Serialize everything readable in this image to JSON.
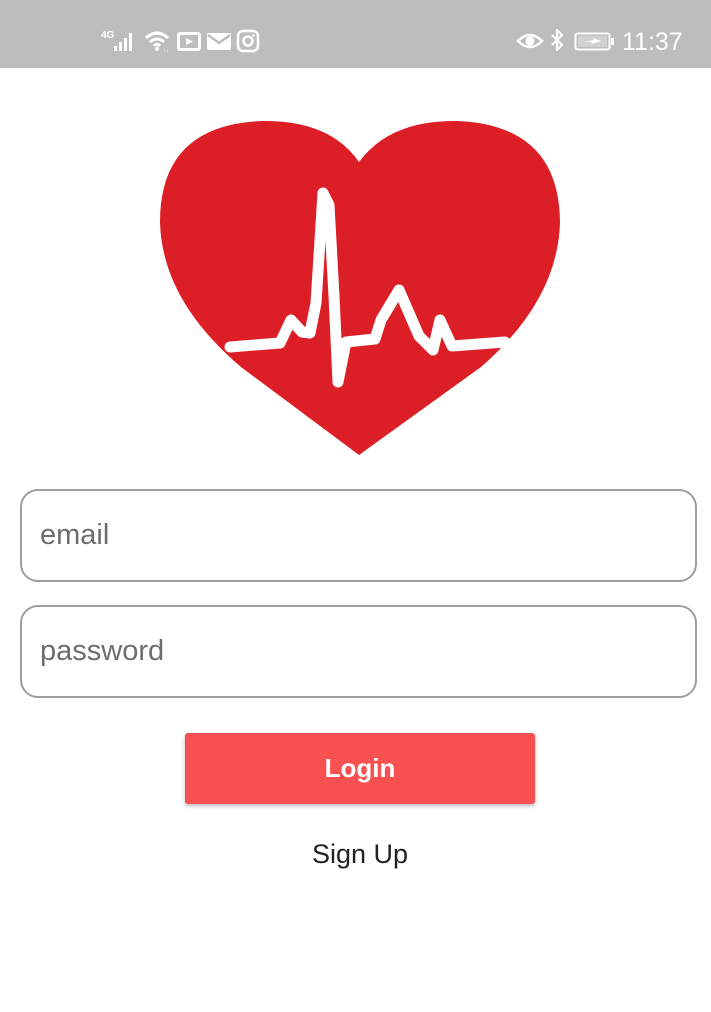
{
  "status_bar": {
    "network_label": "4G",
    "time": "11:37",
    "icons": [
      "cellular-signal-icon",
      "wifi-icon",
      "youtube-icon",
      "mail-icon",
      "instagram-icon",
      "eye-icon",
      "bluetooth-icon",
      "battery-charging-icon"
    ]
  },
  "logo": {
    "icon": "heart-heartbeat-icon",
    "color": "#dc1f26"
  },
  "form": {
    "email_placeholder": "email",
    "password_placeholder": "password",
    "login_label": "Login",
    "signup_label": "Sign Up"
  },
  "colors": {
    "accent": "#f95052",
    "status_bar": "#bdbdbd",
    "field_border": "#9e9e9e"
  }
}
